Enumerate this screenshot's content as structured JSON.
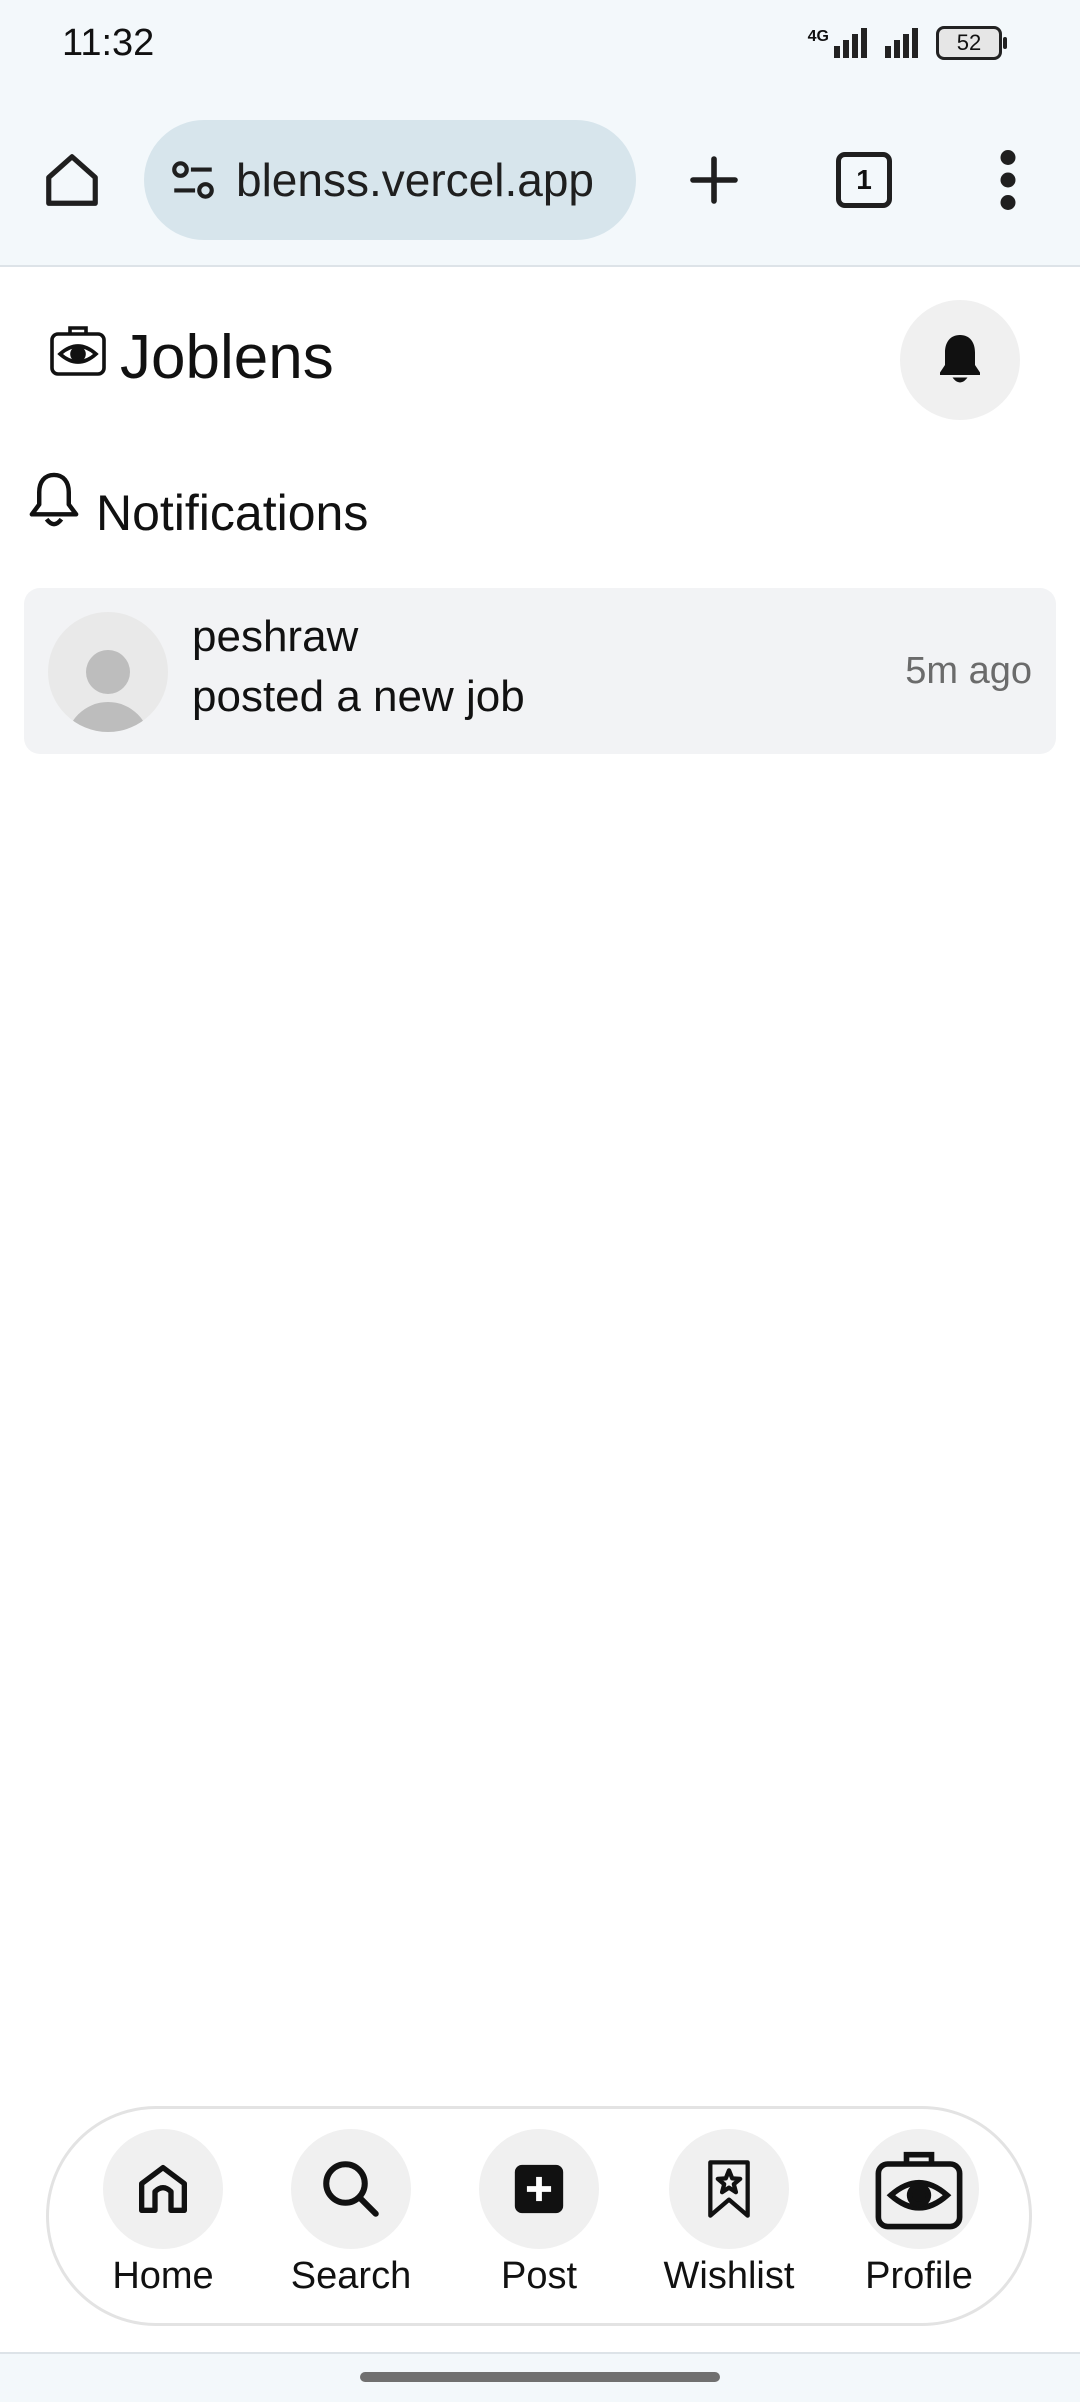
{
  "status_bar": {
    "time": "11:32",
    "network": "4G",
    "battery": "52"
  },
  "browser": {
    "url": "blenss.vercel.app",
    "tab_count": "1",
    "icons": [
      "home-icon",
      "site-settings-icon",
      "new-tab-icon",
      "tab-switcher-icon",
      "more-menu-icon"
    ]
  },
  "app": {
    "title": "Joblens",
    "logo_icon": "briefcase-eye-icon",
    "bell_icon": "bell-icon"
  },
  "notifications": {
    "heading": "Notifications",
    "items": [
      {
        "user": "peshraw",
        "message": "posted a new job",
        "time": "5m ago"
      }
    ]
  },
  "bottom_nav": {
    "items": [
      {
        "label": "Home",
        "icon": "home-icon"
      },
      {
        "label": "Search",
        "icon": "search-icon"
      },
      {
        "label": "Post",
        "icon": "add-post-icon"
      },
      {
        "label": "Wishlist",
        "icon": "bookmark-star-icon"
      },
      {
        "label": "Profile",
        "icon": "briefcase-eye-icon"
      }
    ]
  }
}
